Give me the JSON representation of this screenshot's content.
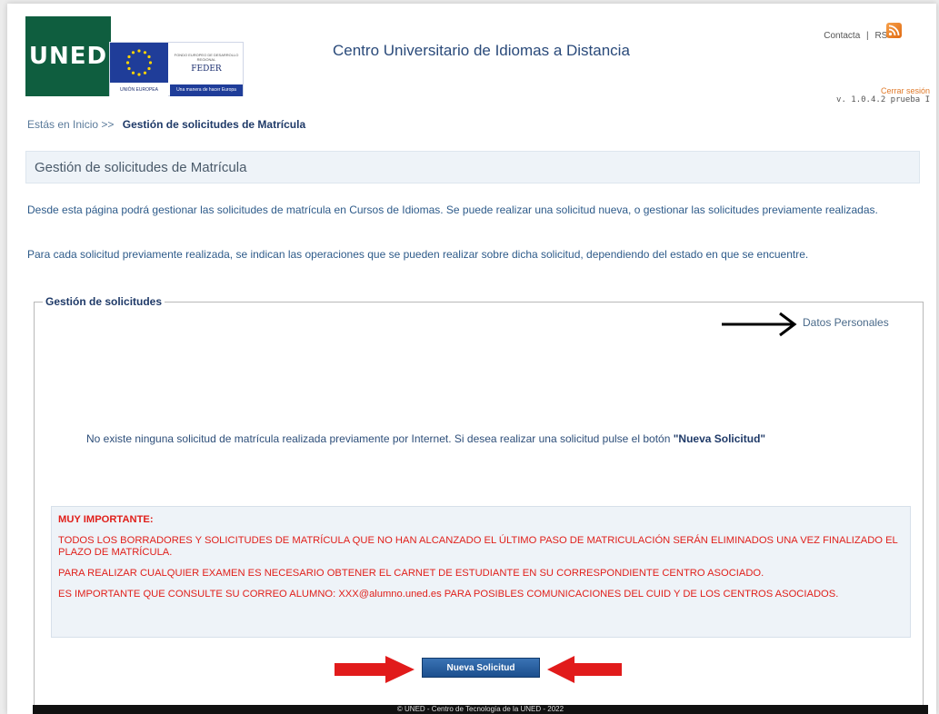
{
  "header": {
    "logo_text": "UNED",
    "feder_small": "FONDO EUROPEO DE DESARROLLO REGIONAL",
    "feder_text": "FEDER",
    "feder_strip_left": "UNIÓN EUROPEA",
    "feder_strip_right": "Una manera de hacer Europa",
    "site_title": "Centro Universitario de Idiomas a Distancia",
    "contact_label": "Contacta",
    "separator": "|",
    "rss_label": "RSS",
    "logout_label": "Cerrar sesión",
    "version": "v. 1.0.4.2 prueba I"
  },
  "breadcrumb": {
    "prefix": "Estás en Inicio >>",
    "current": "Gestión de solicitudes de Matrícula"
  },
  "page": {
    "title": "Gestión de solicitudes de Matrícula",
    "intro_1": "Desde esta página podrá gestionar las solicitudes de matrícula en Cursos de Idiomas. Se puede realizar una solicitud nueva, o gestionar las solicitudes previamente realizadas.",
    "intro_2": "Para cada solicitud previamente realizada, se indican las operaciones que se pueden realizar sobre dicha solicitud, dependiendo del estado en que se encuentre."
  },
  "requests": {
    "legend": "Gestión de solicitudes",
    "personal_data_link": "Datos Personales",
    "empty_message": "No existe ninguna solicitud de matrícula realizada previamente por Internet. Si desea realizar una solicitud pulse el botón",
    "empty_message_button_ref": "\"Nueva Solicitud\"",
    "important": {
      "title": "MUY IMPORTANTE:",
      "notice_1": "TODOS LOS BORRADORES Y SOLICITUDES DE MATRÍCULA QUE NO HAN ALCANZADO EL ÚLTIMO PASO DE MATRICULACIÓN SERÁN ELIMINADOS UNA VEZ FINALIZADO EL PLAZO DE MATRÍCULA.",
      "notice_2": "PARA REALIZAR CUALQUIER EXAMEN ES NECESARIO OBTENER EL CARNET DE ESTUDIANTE EN SU CORRESPONDIENTE CENTRO ASOCIADO.",
      "notice_3": "ES IMPORTANTE QUE CONSULTE SU CORREO ALUMNO: XXX@alumno.uned.es PARA POSIBLES COMUNICACIONES DEL CUID Y DE LOS CENTROS ASOCIADOS."
    },
    "new_request_button": "Nueva Solicitud"
  },
  "footer": {
    "text": "© UNED - Centro de Tecnología de la UNED - 2022"
  },
  "colors": {
    "uned_green": "#0f5e3f",
    "link_blue": "#2e5b8a",
    "alert_red": "#e0201b",
    "annotation_red": "#e11b1b",
    "button_blue": "#1c4f8e"
  },
  "icons": {
    "rss": "rss-icon",
    "eu_flag": "eu-flag-icon",
    "annotation_arrow_black": "arrow-right-icon",
    "annotation_arrow_red": "arrow-icon"
  }
}
